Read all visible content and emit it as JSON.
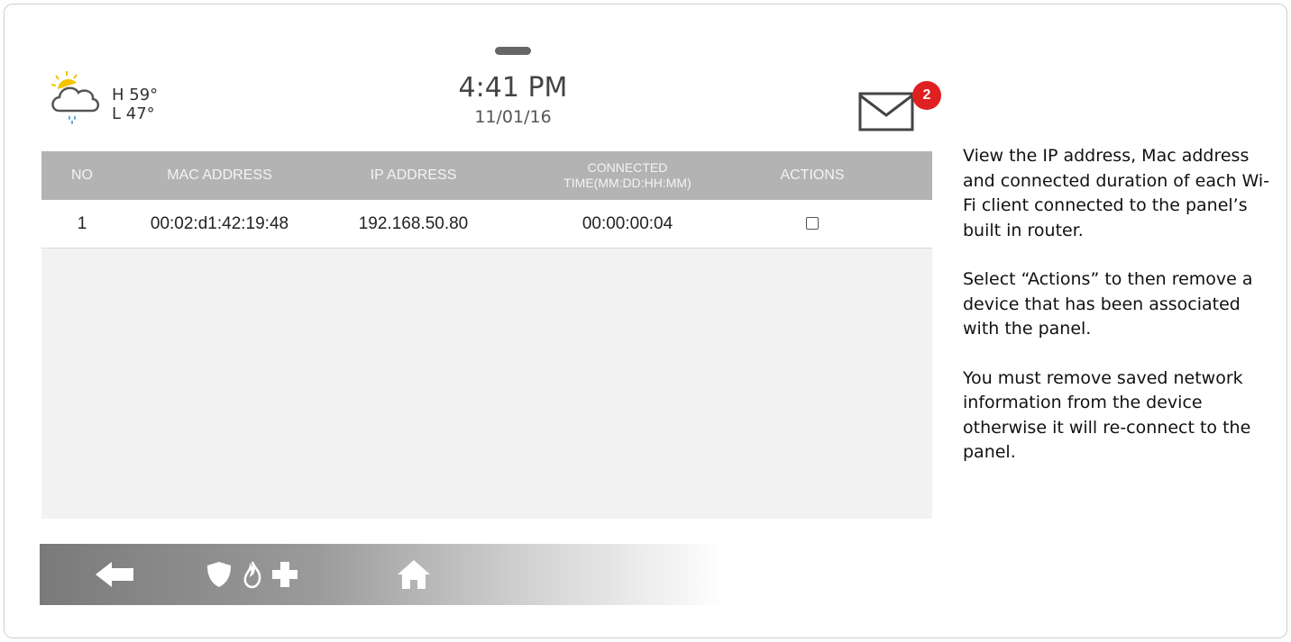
{
  "weather": {
    "high": "H 59°",
    "low": "L 47°",
    "icon": "cloud-rain-sun-icon"
  },
  "clock": {
    "time": "4:41 PM",
    "date": "11/01/16"
  },
  "messages": {
    "icon": "envelope-icon",
    "badge_count": "2"
  },
  "table": {
    "headers": {
      "no": "NO",
      "mac": "MAC ADDRESS",
      "ip": "IP ADDRESS",
      "connected_line1": "CONNECTED",
      "connected_line2": "TIME(MM:DD:HH:MM)",
      "actions": "ACTIONS"
    },
    "rows": [
      {
        "no": "1",
        "mac": "00:02:d1:42:19:48",
        "ip": "192.168.50.80",
        "connected": "00:00:00:04",
        "action_checked": false
      }
    ]
  },
  "bottom_bar": {
    "back_icon": "back-arrow-icon",
    "emergency_icons": [
      "shield-icon",
      "fire-icon",
      "medical-cross-icon"
    ],
    "home_icon": "home-icon"
  },
  "description": {
    "paragraphs": [
      "View the IP address, Mac address and connected duration of each Wi-Fi client connected to the panel’s built in router.",
      "Select “Actions” to then remove a device that has been associated with the panel.",
      "You must remove saved network information from the device otherwise it will re-connect to the panel."
    ]
  },
  "colors": {
    "header_bg": "#b3b3b3",
    "badge": "#e02020",
    "sun": "#f5c400",
    "rain": "#3aa0dc"
  }
}
